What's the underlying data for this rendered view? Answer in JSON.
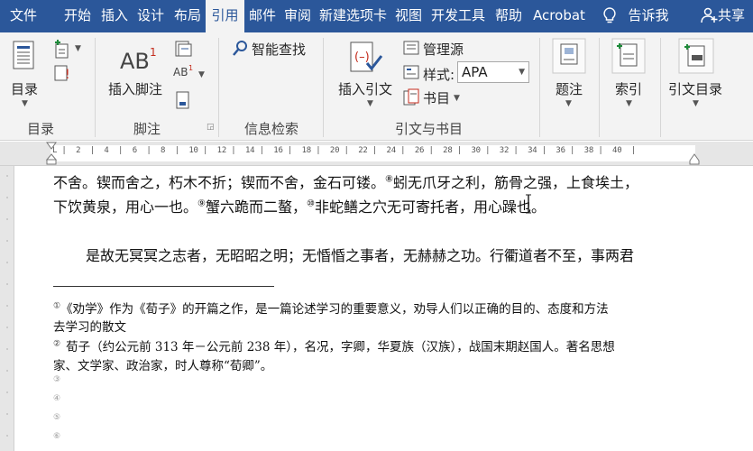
{
  "tabs": [
    "文件",
    "开始",
    "插入",
    "设计",
    "布局",
    "引用",
    "邮件",
    "审阅",
    "新建选项卡",
    "视图",
    "开发工具",
    "帮助",
    "Acrobat",
    "告诉我",
    "共享"
  ],
  "ribbon": {
    "toc": {
      "label": "目录",
      "group": "目录"
    },
    "footnotes": {
      "insert_label": "插入脚注",
      "group": "脚注"
    },
    "research": {
      "smart_lookup": "智能查找",
      "group": "信息检索"
    },
    "citations": {
      "insert_label": "插入引文",
      "manage_sources": "管理源",
      "style_label": "样式:",
      "style_value": "APA",
      "bibliography": "书目",
      "group": "引文与书目"
    },
    "captions": {
      "label": "题注"
    },
    "index": {
      "label": "索引"
    },
    "toa": {
      "label": "引文目录"
    }
  },
  "ruler": {
    "text": "L |  2  |  4  |  6  |  8  |  10 |  12 |  14 |  16 |  18 |  20 |  22 |  24 |  26 |  28 |  30 |  32 |  34 |  36 |  38 |  40  |"
  },
  "document": {
    "line1": {
      "text_a": "不舍。锲而舍之，朽木不折；锲而不舍，金石可镂。",
      "mark": "⑧",
      "text_b": "蚓无爪牙之利，筋骨之强，上食埃土，"
    },
    "line2": {
      "text_a": "下饮黄泉，用心一也。",
      "mark_a": "⑨",
      "text_b": "蟹六跪而二螯，",
      "mark_b": "⑩",
      "text_c": "非蛇鳝之穴无可寄托者，用心躁也。"
    },
    "line3": "是故无冥冥之志者，无昭昭之明；无惛惛之事者，无赫赫之功。行衢道者不至，事两君",
    "footnotes": [
      {
        "mark": "①",
        "line1": "《劝学》作为《荀子》的开篇之作，是一篇论述学习的重要意义，劝导人们以正确的目的、态度和方法",
        "line2": "去学习的散文"
      },
      {
        "mark": "②",
        "line1": "荀子（约公元前 313 年－公元前 238 年），名况，字卿，华夏族（汉族），战国末期赵国人。著名思想",
        "line2": "家、文学家、政治家，时人尊称“荀卿”。"
      }
    ],
    "empty_marks": [
      "③",
      "④",
      "⑤",
      "⑥"
    ]
  }
}
